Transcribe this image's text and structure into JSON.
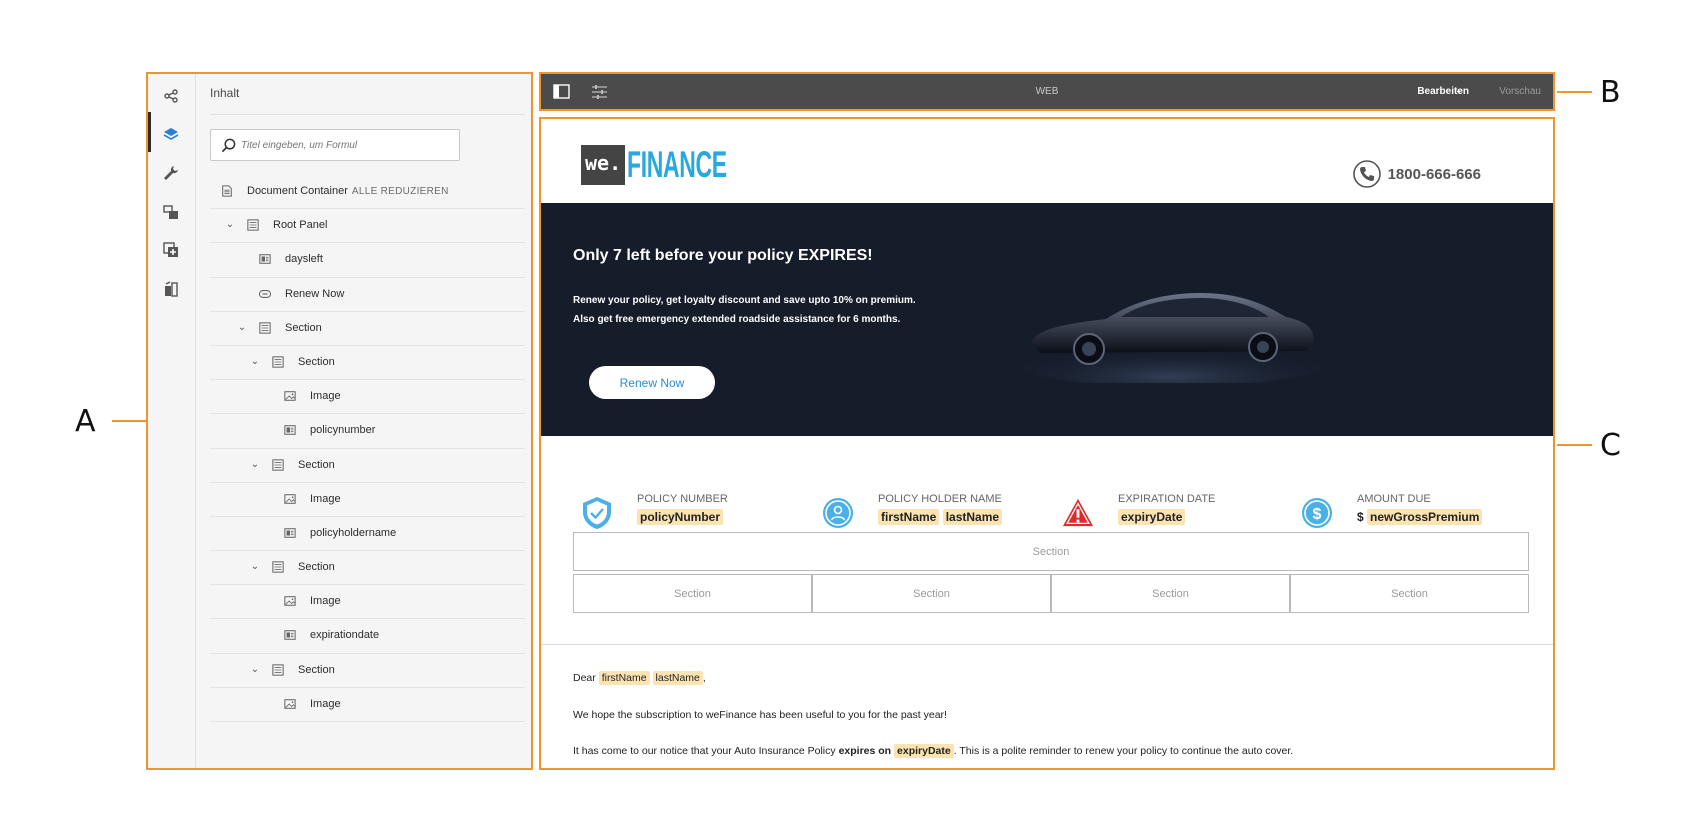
{
  "callouts": {
    "a": "A",
    "b": "B",
    "c": "C"
  },
  "sidebar": {
    "title": "Inhalt",
    "search_placeholder": "Titel eingeben, um Formul",
    "rail_icons": [
      "share-icon",
      "layers-icon",
      "wrench-icon",
      "data-model-icon",
      "add-fragment-icon",
      "assets-icon"
    ],
    "tree": [
      {
        "label": "Document Container",
        "icon": "document-icon",
        "link": "ALLE REDUZIEREN"
      },
      {
        "label": "Root Panel",
        "icon": "panel-icon",
        "expanded": true
      },
      {
        "label": "daysleft",
        "icon": "text-field-icon"
      },
      {
        "label": "Renew Now",
        "icon": "button-icon"
      },
      {
        "label": "Section",
        "icon": "panel-icon",
        "expanded": true
      },
      {
        "label": "Section",
        "icon": "panel-icon",
        "expanded": true
      },
      {
        "label": "Image",
        "icon": "image-icon"
      },
      {
        "label": "policynumber",
        "icon": "text-field-icon"
      },
      {
        "label": "Section",
        "icon": "panel-icon",
        "expanded": true
      },
      {
        "label": "Image",
        "icon": "image-icon"
      },
      {
        "label": "policyholdername",
        "icon": "text-field-icon"
      },
      {
        "label": "Section",
        "icon": "panel-icon",
        "expanded": true
      },
      {
        "label": "Image",
        "icon": "image-icon"
      },
      {
        "label": "expirationdate",
        "icon": "text-field-icon"
      },
      {
        "label": "Section",
        "icon": "panel-icon",
        "expanded": true
      },
      {
        "label": "Image",
        "icon": "image-icon"
      }
    ]
  },
  "toolbar": {
    "center_label": "WEB",
    "mode_label": "Bearbeiten",
    "preview_label": "Vorschau"
  },
  "document": {
    "logo": {
      "we": "we.",
      "finance": "FINANCE"
    },
    "phone": "1800-666-666",
    "hero": {
      "title": "Only 7 left before your policy EXPIRES!",
      "text_line1": "Renew your policy, get loyalty discount and save upto 10% on premium.",
      "text_line2": "Also get free emergency extended roadside assistance for 6 months.",
      "button": "Renew Now"
    },
    "info": [
      {
        "label": "POLICY NUMBER",
        "prefix": "",
        "values": [
          "policyNumber"
        ],
        "icon": "shield-check-icon"
      },
      {
        "label": "POLICY HOLDER NAME",
        "prefix": "",
        "values": [
          "firstName",
          "lastName"
        ],
        "icon": "user-icon"
      },
      {
        "label": "EXPIRATION DATE",
        "prefix": "",
        "values": [
          "expiryDate"
        ],
        "icon": "warning-icon"
      },
      {
        "label": "AMOUNT DUE",
        "prefix": "$",
        "values": [
          "newGrossPremium"
        ],
        "icon": "dollar-icon"
      }
    ],
    "section_label": "Section",
    "letter": {
      "salutation": "Dear",
      "first_name": "firstName",
      "last_name": "lastName",
      "salutation_end": ",",
      "line2": "We hope the subscription to weFinance has been useful to you for the past year!",
      "line3_a": "It has come to our notice that your Auto Insurance Policy",
      "line3_b": "expires on",
      "line3_field": "expiryDate",
      "line3_c": ". This is a polite reminder to renew your policy to continue the auto cover."
    }
  },
  "colors": {
    "callout_border": "#f0952d",
    "toolbar_bg": "#4b4b4b",
    "hero_bg": "#151c2a",
    "accent_blue": "#29a8e0",
    "field_highlight": "#fbe3b2",
    "warning_red": "#e02a2a"
  }
}
